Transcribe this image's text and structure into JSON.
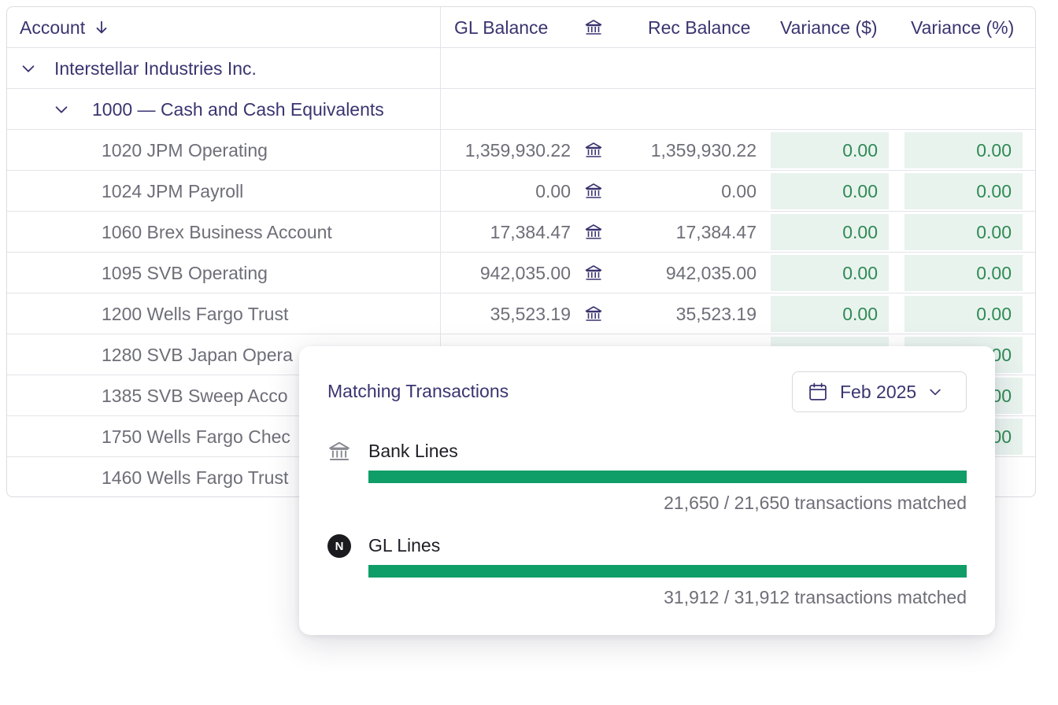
{
  "table": {
    "headers": {
      "account": "Account",
      "gl_balance": "GL Balance",
      "rec_balance": "Rec Balance",
      "variance_usd": "Variance ($)",
      "variance_pct": "Variance (%)"
    },
    "entity": "Interstellar Industries Inc.",
    "group": "1000 — Cash and Cash Equivalents",
    "rows": [
      {
        "account": "1020 JPM Operating",
        "gl": "1,359,930.22",
        "rec": "1,359,930.22",
        "var_usd": "0.00",
        "var_pct": "0.00"
      },
      {
        "account": "1024 JPM Payroll",
        "gl": "0.00",
        "rec": "0.00",
        "var_usd": "0.00",
        "var_pct": "0.00"
      },
      {
        "account": "1060 Brex Business Account",
        "gl": "17,384.47",
        "rec": "17,384.47",
        "var_usd": "0.00",
        "var_pct": "0.00"
      },
      {
        "account": "1095 SVB Operating",
        "gl": "942,035.00",
        "rec": "942,035.00",
        "var_usd": "0.00",
        "var_pct": "0.00"
      },
      {
        "account": "1200 Wells Fargo Trust",
        "gl": "35,523.19",
        "rec": "35,523.19",
        "var_usd": "0.00",
        "var_pct": "0.00"
      },
      {
        "account": "1280 SVB Japan Opera",
        "gl": "",
        "rec": "",
        "var_usd": "",
        "var_pct": "00"
      },
      {
        "account": "1385 SVB Sweep Acco",
        "gl": "",
        "rec": "",
        "var_usd": "",
        "var_pct": "00"
      },
      {
        "account": "1750 Wells Fargo Chec",
        "gl": "",
        "rec": "",
        "var_usd": "",
        "var_pct": "00"
      },
      {
        "account": "1460 Wells Fargo Trust",
        "gl": "",
        "rec": "",
        "var_usd": "",
        "var_pct": ""
      }
    ]
  },
  "popover": {
    "title": "Matching Transactions",
    "date": "Feb 2025",
    "sections": [
      {
        "icon": "bank-icon",
        "label": "Bank Lines",
        "matched": 21650,
        "total": 21650,
        "count_text": "21,650 / 21,650 transactions matched"
      },
      {
        "icon": "netsuite-n-icon",
        "label": "GL Lines",
        "badge": "N",
        "matched": 31912,
        "total": 31912,
        "count_text": "31,912 / 31,912 transactions matched"
      }
    ]
  },
  "colors": {
    "accent_text": "#3a3470",
    "variance_bg": "#e9f3ee",
    "variance_text": "#2f8a55",
    "bar_fill": "#0f9d68"
  }
}
